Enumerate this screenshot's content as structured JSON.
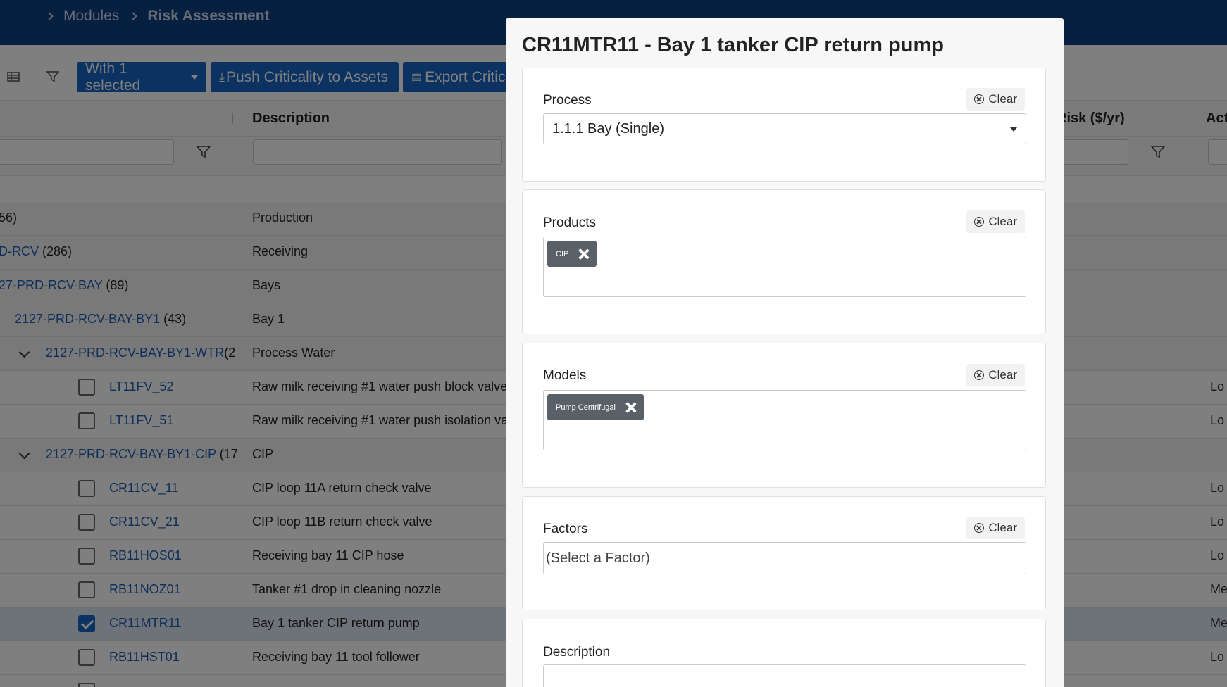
{
  "breadcrumb": {
    "modules": "Modules",
    "current": "Risk Assessment"
  },
  "toolbar": {
    "with_selected": "With 1 selected",
    "push_criticality": "Push Criticality to Assets",
    "export_criticality": "Export Critic"
  },
  "grid": {
    "columns": {
      "description": "Description",
      "risk": "Risk ($/yr)",
      "action": "Act"
    },
    "rows": [
      {
        "id": "56)",
        "count": "",
        "desc": "Production",
        "right": ""
      },
      {
        "id": "D-RCV",
        "count": "(286)",
        "desc": "Receiving",
        "right": ""
      },
      {
        "id": "27-PRD-RCV-BAY",
        "count": "(89)",
        "desc": "Bays",
        "right": ""
      },
      {
        "id": "2127-PRD-RCV-BAY-BY1",
        "count": "(43)",
        "desc": "Bay 1",
        "right": ""
      },
      {
        "id": "2127-PRD-RCV-BAY-BY1-WTR",
        "count": "(2",
        "desc": "Process Water",
        "right": ""
      },
      {
        "id": "LT11FV_52",
        "count": "",
        "desc": "Raw milk receiving #1 water push block valve",
        "right": "Lo"
      },
      {
        "id": "LT11FV_51",
        "count": "",
        "desc": "Raw milk receiving #1 water push isolation val",
        "right": "Lo"
      },
      {
        "id": "2127-PRD-RCV-BAY-BY1-CIP",
        "count": "(17",
        "desc": "CIP",
        "right": ""
      },
      {
        "id": "CR11CV_11",
        "count": "",
        "desc": "CIP loop 11A return check valve",
        "right": "Lo"
      },
      {
        "id": "CR11CV_21",
        "count": "",
        "desc": "CIP loop 11B return check valve",
        "right": "Lo"
      },
      {
        "id": "RB11HOS01",
        "count": "",
        "desc": "Receiving bay 11 CIP hose",
        "right": "Lo"
      },
      {
        "id": "RB11NOZ01",
        "count": "",
        "desc": "Tanker #1 drop in cleaning nozzle",
        "right": "Me"
      },
      {
        "id": "CR11MTR11",
        "count": "",
        "desc": "Bay 1 tanker CIP return pump",
        "right": "Me"
      },
      {
        "id": "RB11HST01",
        "count": "",
        "desc": "Receiving bay 11 tool follower",
        "right": "Lo"
      }
    ]
  },
  "modal": {
    "title": "CR11MTR11 - Bay 1 tanker CIP return pump",
    "clear_label": "Clear",
    "process": {
      "label": "Process",
      "value": "1.1.1 Bay (Single)"
    },
    "products": {
      "label": "Products",
      "tags": [
        "CIP"
      ]
    },
    "models": {
      "label": "Models",
      "tags": [
        "Pump Centrifugal"
      ]
    },
    "factors": {
      "label": "Factors",
      "placeholder": "(Select a Factor)"
    },
    "description": {
      "label": "Description",
      "value": ""
    }
  }
}
